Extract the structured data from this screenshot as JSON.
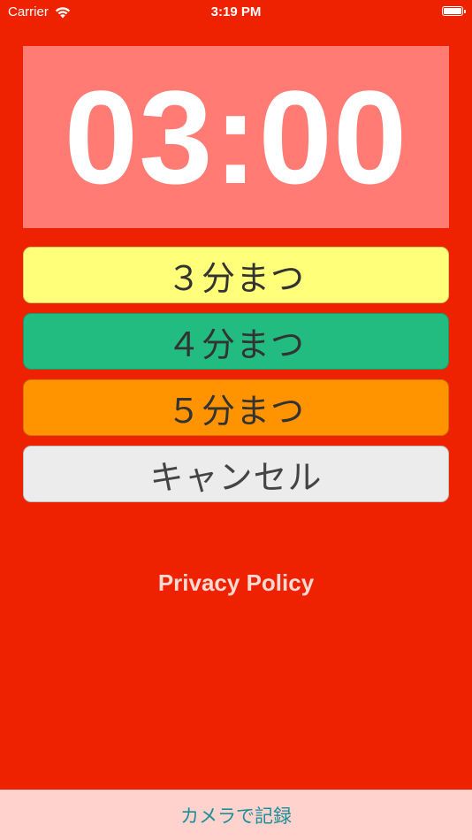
{
  "status_bar": {
    "carrier": "Carrier",
    "time": "3:19 PM",
    "wifi_icon": "wifi-icon",
    "battery_icon": "battery-icon"
  },
  "timer": {
    "display": "03:00"
  },
  "buttons": {
    "wait_3": "３分まつ",
    "wait_4": "４分まつ",
    "wait_5": "５分まつ",
    "cancel": "キャンセル"
  },
  "links": {
    "privacy_policy": "Privacy Policy"
  },
  "bottom_bar": {
    "record_label": "カメラで記録"
  },
  "colors": {
    "background": "#ee2200",
    "timer_bg": "#ff7b74",
    "wait_3_bg": "#ffff79",
    "wait_4_bg": "#22bb80",
    "wait_5_bg": "#ff9300",
    "cancel_bg": "#ececec",
    "bottom_bar_bg": "#ffd2cd",
    "bottom_bar_text": "#1a8f99"
  }
}
